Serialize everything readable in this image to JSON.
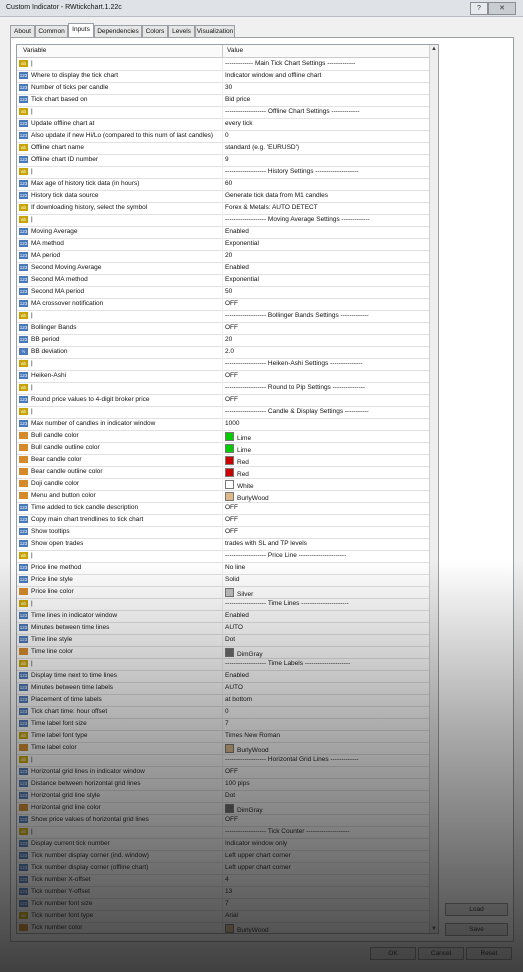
{
  "window": {
    "title": "Custom Indicator - RWtickchart.1.22c",
    "help": "?",
    "close": "✕"
  },
  "tabs": [
    "About",
    "Common",
    "Inputs",
    "Dependencies",
    "Colors",
    "Levels",
    "Visualization"
  ],
  "columns": {
    "variable": "Variable",
    "value": "Value"
  },
  "rows": [
    {
      "t": "ab",
      "n": "|",
      "v": "------------- Main Tick Chart Settings -------------"
    },
    {
      "t": "123",
      "n": "Where to display the tick chart",
      "v": "Indicator window and offline chart"
    },
    {
      "t": "123",
      "n": "Number of ticks per candle",
      "v": "30"
    },
    {
      "t": "123",
      "n": "Tick chart based on",
      "v": "Bid price"
    },
    {
      "t": "ab",
      "n": "|",
      "v": "------------------- Offline Chart Settings -------------"
    },
    {
      "t": "123",
      "n": "Update offline chart at",
      "v": "every tick"
    },
    {
      "t": "123",
      "n": "Also update if new Hi/Lo (compared to this num of last candles)",
      "v": "0"
    },
    {
      "t": "ab",
      "n": "Offline chart name",
      "v": "standard (e.g. 'EURUSD')"
    },
    {
      "t": "123",
      "n": "Offline chart ID number",
      "v": "9"
    },
    {
      "t": "ab",
      "n": "|",
      "v": "------------------- History Settings --------------------"
    },
    {
      "t": "123",
      "n": "Max age of history tick data (in hours)",
      "v": "60"
    },
    {
      "t": "123",
      "n": "History tick data source",
      "v": "Generate tick data from M1 candles"
    },
    {
      "t": "ab",
      "n": "If downloading history, select the symbol",
      "v": "Forex & Metals:  AUTO DETECT"
    },
    {
      "t": "ab",
      "n": "|",
      "v": "------------------- Moving Average Settings -------------"
    },
    {
      "t": "123",
      "n": "Moving Average",
      "v": "Enabled"
    },
    {
      "t": "123",
      "n": "MA method",
      "v": "Exponential"
    },
    {
      "t": "123",
      "n": "MA period",
      "v": "20"
    },
    {
      "t": "123",
      "n": "Second Moving Average",
      "v": "Enabled"
    },
    {
      "t": "123",
      "n": "Second MA method",
      "v": "Exponential"
    },
    {
      "t": "123",
      "n": "Second MA period",
      "v": "50"
    },
    {
      "t": "123",
      "n": "MA crossover notification",
      "v": "OFF"
    },
    {
      "t": "ab",
      "n": "|",
      "v": "------------------- Bollinger Bands Settings -------------"
    },
    {
      "t": "123",
      "n": "Bollinger Bands",
      "v": "OFF"
    },
    {
      "t": "123",
      "n": "BB period",
      "v": "20"
    },
    {
      "t": "1/2",
      "n": "BB deviation",
      "v": "2.0"
    },
    {
      "t": "ab",
      "n": "|",
      "v": "------------------- Heiken-Ashi Settings ---------------"
    },
    {
      "t": "123",
      "n": "Heiken-Ashi",
      "v": "OFF"
    },
    {
      "t": "ab",
      "n": "|",
      "v": "------------------- Round to Pip Settings ---------------"
    },
    {
      "t": "123",
      "n": "Round price values to 4-digit broker price",
      "v": "OFF"
    },
    {
      "t": "ab",
      "n": "|",
      "v": "------------------- Candle & Display Settings -----------"
    },
    {
      "t": "123",
      "n": "Max number of candles in indicator window",
      "v": "1000"
    },
    {
      "t": "clr",
      "n": "Bull candle color",
      "v": "Lime",
      "c": "#00cc00"
    },
    {
      "t": "clr",
      "n": "Bull candle outline color",
      "v": "Lime",
      "c": "#00cc00"
    },
    {
      "t": "clr",
      "n": "Bear candle color",
      "v": "Red",
      "c": "#cc0000"
    },
    {
      "t": "clr",
      "n": "Bear candle outline color",
      "v": "Red",
      "c": "#cc0000"
    },
    {
      "t": "clr",
      "n": "Doji candle color",
      "v": "White",
      "c": "#ffffff"
    },
    {
      "t": "clr",
      "n": "Menu and button color",
      "v": "BurlyWood",
      "c": "#deb887"
    },
    {
      "t": "123",
      "n": "Time added to tick candle description",
      "v": "OFF"
    },
    {
      "t": "123",
      "n": "Copy main chart trendlines to tick chart",
      "v": "OFF"
    },
    {
      "t": "123",
      "n": "Show tooltips",
      "v": "OFF"
    },
    {
      "t": "123",
      "n": "Show open trades",
      "v": "trades with SL and TP levels"
    },
    {
      "t": "ab",
      "n": "|",
      "v": "------------------- Price Line ----------------------"
    },
    {
      "t": "123",
      "n": "Price line method",
      "v": "No line"
    },
    {
      "t": "123",
      "n": "Price line style",
      "v": "Solid"
    },
    {
      "t": "clr",
      "n": "Price line color",
      "v": "Silver",
      "c": "#c0c0c0"
    },
    {
      "t": "ab",
      "n": "|",
      "v": "------------------- Time Lines ----------------------"
    },
    {
      "t": "123",
      "n": "Time lines in indicator window",
      "v": "Enabled"
    },
    {
      "t": "123",
      "n": "Minutes between time lines",
      "v": "AUTO"
    },
    {
      "t": "123",
      "n": "Time line style",
      "v": "Dot"
    },
    {
      "t": "clr",
      "n": "Time line color",
      "v": "DimGray",
      "c": "#696969"
    },
    {
      "t": "ab",
      "n": "|",
      "v": "------------------- Time Labels ---------------------"
    },
    {
      "t": "123",
      "n": "Display time next to time lines",
      "v": "Enabled"
    },
    {
      "t": "123",
      "n": "Minutes between time labels",
      "v": "AUTO"
    },
    {
      "t": "123",
      "n": "Placement of time labels",
      "v": "at bottom"
    },
    {
      "t": "123",
      "n": "Tick chart time:  hour offset",
      "v": "0"
    },
    {
      "t": "123",
      "n": "Time label font size",
      "v": "7"
    },
    {
      "t": "ab",
      "n": "Time label font type",
      "v": "Times New Roman"
    },
    {
      "t": "clr",
      "n": "Time label color",
      "v": "BurlyWood",
      "c": "#deb887"
    },
    {
      "t": "ab",
      "n": "|",
      "v": "------------------- Horizontal Grid Lines -------------"
    },
    {
      "t": "123",
      "n": "Horizontal grid lines in indicator window",
      "v": "OFF"
    },
    {
      "t": "123",
      "n": "Distance between horizontal grid lines",
      "v": "100 pips"
    },
    {
      "t": "123",
      "n": "Horizontal grid line style",
      "v": "Dot"
    },
    {
      "t": "clr",
      "n": "Horizontal grid line color",
      "v": "DimGray",
      "c": "#696969"
    },
    {
      "t": "123",
      "n": "Show price values of horizontal grid lines",
      "v": "OFF"
    },
    {
      "t": "ab",
      "n": "|",
      "v": "------------------- Tick Counter --------------------"
    },
    {
      "t": "123",
      "n": "Display current tick number",
      "v": "Indicator window only"
    },
    {
      "t": "123",
      "n": "Tick number display corner (ind. window)",
      "v": "Left upper chart corner"
    },
    {
      "t": "123",
      "n": "Tick number display corner (offline chart)",
      "v": "Left upper chart corner"
    },
    {
      "t": "123",
      "n": "Tick number X-offset",
      "v": "4"
    },
    {
      "t": "123",
      "n": "Tick number Y-offset",
      "v": "13"
    },
    {
      "t": "123",
      "n": "Tick number font size",
      "v": "7"
    },
    {
      "t": "ab",
      "n": "Tick number font type",
      "v": "Arial"
    },
    {
      "t": "clr",
      "n": "Tick number color",
      "v": "BurlyWood",
      "c": "#deb887"
    }
  ],
  "buttons": {
    "load": "Load",
    "save": "Save",
    "ok": "OK",
    "cancel": "Cancel",
    "reset": "Reset"
  }
}
